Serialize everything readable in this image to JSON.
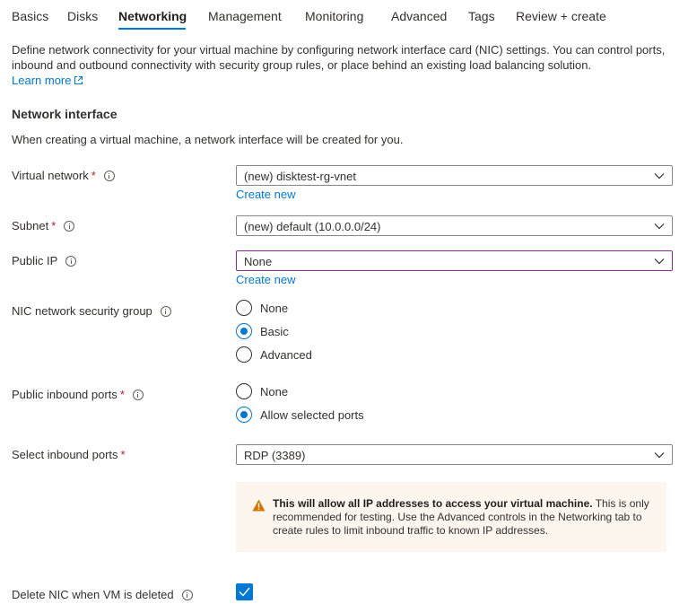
{
  "tabs": [
    {
      "label": "Basics",
      "active": false
    },
    {
      "label": "Disks",
      "active": false
    },
    {
      "label": "Networking",
      "active": true
    },
    {
      "label": "Management",
      "active": false
    },
    {
      "label": "Monitoring",
      "active": false
    },
    {
      "label": "Advanced",
      "active": false
    },
    {
      "label": "Tags",
      "active": false
    },
    {
      "label": "Review + create",
      "active": false
    }
  ],
  "intro": {
    "description": "Define network connectivity for your virtual machine by configuring network interface card (NIC) settings. You can control ports, inbound and outbound connectivity with security group rules, or place behind an existing load balancing solution.",
    "learn_more": "Learn more"
  },
  "network_interface": {
    "title": "Network interface",
    "description": "When creating a virtual machine, a network interface will be created for you."
  },
  "fields": {
    "virtual_network": {
      "label": "Virtual network",
      "required": "*",
      "value": "(new) disktest-rg-vnet",
      "create_new": "Create new"
    },
    "subnet": {
      "label": "Subnet",
      "required": "*",
      "value": "(new) default (10.0.0.0/24)"
    },
    "public_ip": {
      "label": "Public IP",
      "value": "None",
      "create_new": "Create new"
    },
    "nic_nsg": {
      "label": "NIC network security group",
      "options": [
        "None",
        "Basic",
        "Advanced"
      ],
      "selected": "Basic"
    },
    "public_inbound_ports": {
      "label": "Public inbound ports",
      "required": "*",
      "options": [
        "None",
        "Allow selected ports"
      ],
      "selected": "Allow selected ports"
    },
    "select_inbound_ports": {
      "label": "Select inbound ports",
      "required": "*",
      "value": "RDP (3389)"
    },
    "delete_nic": {
      "label": "Delete NIC when VM is deleted",
      "checked": true
    }
  },
  "warning": {
    "bold": "This will allow all IP addresses to access your virtual machine.",
    "text": " This is only recommended for testing.  Use the Advanced controls in the Networking tab to create rules to limit inbound traffic to known IP addresses."
  },
  "colors": {
    "accent": "#0078d4",
    "required": "#a4262c",
    "warning_bg": "#fdf6ee",
    "warning_icon": "#d47500",
    "focus_border": "#8a2b8f"
  }
}
